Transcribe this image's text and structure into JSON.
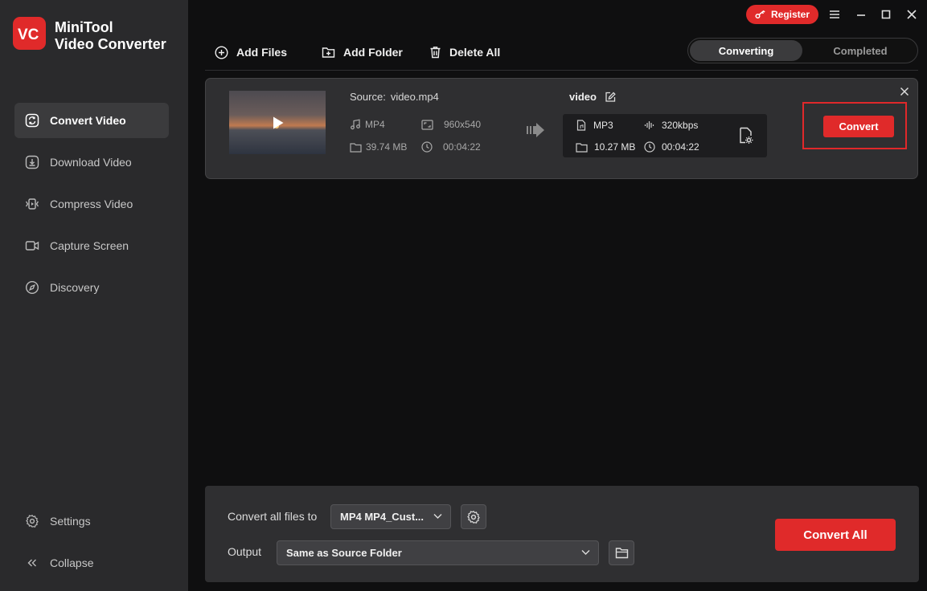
{
  "app": {
    "name_line1": "MiniTool",
    "name_line2": "Video Converter"
  },
  "window": {
    "register_label": "Register"
  },
  "sidebar": {
    "items": [
      {
        "label": "Convert Video",
        "icon": "convert-icon",
        "active": true
      },
      {
        "label": "Download Video",
        "icon": "download-icon"
      },
      {
        "label": "Compress Video",
        "icon": "compress-icon"
      },
      {
        "label": "Capture Screen",
        "icon": "camera-icon"
      },
      {
        "label": "Discovery",
        "icon": "compass-icon"
      }
    ],
    "settings_label": "Settings",
    "collapse_label": "Collapse"
  },
  "toolbar": {
    "add_files": "Add Files",
    "add_folder": "Add Folder",
    "delete_all": "Delete All"
  },
  "tabs": {
    "converting": "Converting",
    "completed": "Completed"
  },
  "file": {
    "source_key": "Source:",
    "source_name": "video.mp4",
    "format": "MP4",
    "resolution": "960x540",
    "size": "39.74 MB",
    "duration": "00:04:22",
    "target_name": "video",
    "target_format": "MP3",
    "target_bitrate": "320kbps",
    "target_size": "10.27 MB",
    "target_duration": "00:04:22",
    "convert_label": "Convert"
  },
  "bottom": {
    "convert_all_files_to_label": "Convert all files to",
    "format_value": "MP4 MP4_Cust...",
    "output_label": "Output",
    "output_value": "Same as Source Folder",
    "convert_all_label": "Convert All"
  },
  "colors": {
    "accent": "#e02a2a",
    "sidebar_bg": "#2a2a2c",
    "main_bg": "#0f0f10",
    "card_bg": "#2f2f31"
  }
}
